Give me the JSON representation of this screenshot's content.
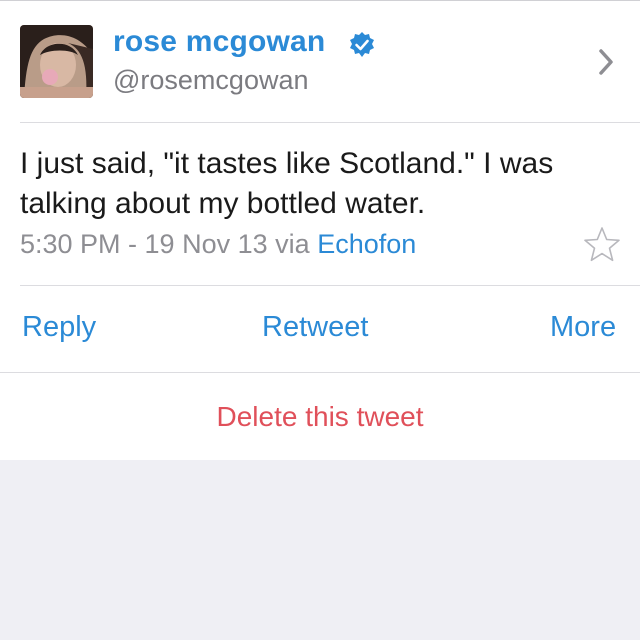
{
  "profile": {
    "display_name": "rose mcgowan",
    "handle": "@rosemcgowan",
    "verified": true
  },
  "tweet": {
    "text": "I just said, \"it tastes like Scotland.\"  I was talking about my bottled water.",
    "time": "5:30 PM - 19 Nov 13",
    "via_label": "via",
    "via_app": "Echofon"
  },
  "actions": {
    "reply": "Reply",
    "retweet": "Retweet",
    "more": "More",
    "delete": "Delete this tweet"
  },
  "icons": {
    "verified": "verified-badge-icon",
    "chevron": "chevron-right-icon",
    "favorite": "star-outline-icon"
  },
  "colors": {
    "link_blue": "#2b8ad6",
    "delete_red": "#e0505a",
    "secondary_gray": "#8e8e93",
    "background": "#efeff4"
  }
}
